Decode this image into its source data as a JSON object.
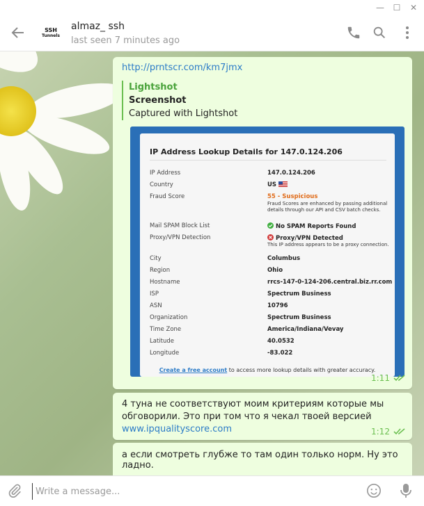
{
  "window": {
    "minimize": "—",
    "maximize": "☐",
    "close": "✕"
  },
  "header": {
    "avatar_line1": "SSH",
    "avatar_line2": "Tunnels",
    "contact_name": "almaz_ ssh",
    "status": "last seen 7 minutes ago"
  },
  "messages": {
    "m1": {
      "link": "http://prntscr.com/km7jmx",
      "preview_site": "Lightshot",
      "preview_title": "Screenshot",
      "preview_desc": "Captured with Lightshot",
      "time": "1:11"
    },
    "m2": {
      "text": "4 туна не соответствуют моим критериям которые мы обговорили. Это при том что я чекал твоей версией",
      "link": "www.ipqualityscore.com",
      "time": "1:12"
    },
    "m3": {
      "text": "а если смотреть глубже то там один только норм. Ну это ладно."
    }
  },
  "screenshot": {
    "title": "IP Address Lookup Details for 147.0.124.206",
    "rows": [
      {
        "key": "IP Address",
        "value": "147.0.124.206"
      },
      {
        "key": "Country",
        "value": "US"
      },
      {
        "key": "Fraud Score",
        "value": "55 - Suspicious",
        "note": "Fraud Scores are enhanced by passing additional",
        "note2": "details through our API and CSV batch checks."
      },
      {
        "key": "Mail SPAM Block List",
        "value": "No SPAM Reports Found"
      },
      {
        "key": "Proxy/VPN Detection",
        "value": "Proxy/VPN Detected",
        "note": "This IP address appears to be a proxy connection."
      },
      {
        "key": "City",
        "value": "Columbus"
      },
      {
        "key": "Region",
        "value": "Ohio"
      },
      {
        "key": "Hostname",
        "value": "rrcs-147-0-124-206.central.biz.rr.com"
      },
      {
        "key": "ISP",
        "value": "Spectrum Business"
      },
      {
        "key": "ASN",
        "value": "10796"
      },
      {
        "key": "Organization",
        "value": "Spectrum Business"
      },
      {
        "key": "Time Zone",
        "value": "America/Indiana/Vevay"
      },
      {
        "key": "Latitude",
        "value": "40.0532"
      },
      {
        "key": "Longitude",
        "value": "-83.022"
      }
    ],
    "footer_link": "Create a free account",
    "footer_text": " to access more lookup details with greater accuracy."
  },
  "composer": {
    "placeholder": "Write a message..."
  },
  "colors": {
    "accent": "#6bbf51",
    "link": "#2b7bc7",
    "bubble": "#eefedf",
    "warn": "#e06c1a"
  }
}
